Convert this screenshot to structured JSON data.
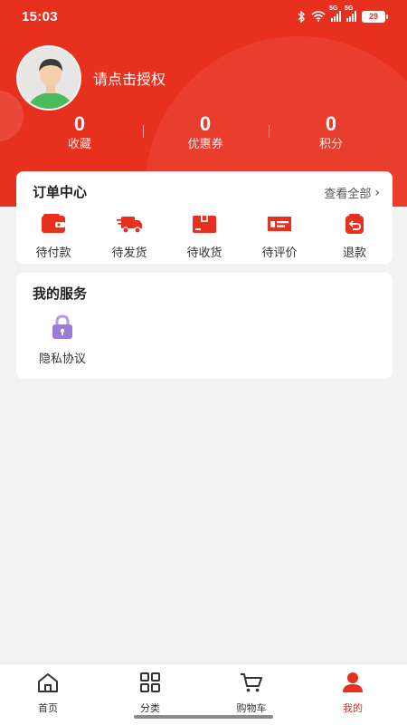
{
  "status_bar": {
    "time": "15:03",
    "battery": "29",
    "signal_label_1": "5G",
    "signal_label_2": "5G"
  },
  "profile": {
    "login_prompt": "请点击授权"
  },
  "stats": [
    {
      "value": "0",
      "label": "收藏"
    },
    {
      "value": "0",
      "label": "优惠券"
    },
    {
      "value": "0",
      "label": "积分"
    }
  ],
  "orders": {
    "title": "订单中心",
    "see_all": "查看全部",
    "items": [
      {
        "label": "待付款",
        "icon": "wallet-icon"
      },
      {
        "label": "待发货",
        "icon": "delivery-truck-icon"
      },
      {
        "label": "待收货",
        "icon": "package-box-icon"
      },
      {
        "label": "待评价",
        "icon": "review-card-icon"
      },
      {
        "label": "退款",
        "icon": "refund-icon"
      }
    ]
  },
  "services": {
    "title": "我的服务",
    "items": [
      {
        "label": "隐私协议",
        "icon": "lock-icon"
      }
    ]
  },
  "tabbar": {
    "items": [
      {
        "label": "首页",
        "icon": "home-icon"
      },
      {
        "label": "分类",
        "icon": "grid-icon"
      },
      {
        "label": "购物车",
        "icon": "cart-icon"
      },
      {
        "label": "我的",
        "icon": "user-icon",
        "active": true
      }
    ]
  },
  "colors": {
    "brand_red": "#e8301f",
    "lock_purple": "#9b7bd8",
    "page_bg": "#f2f2f2"
  }
}
